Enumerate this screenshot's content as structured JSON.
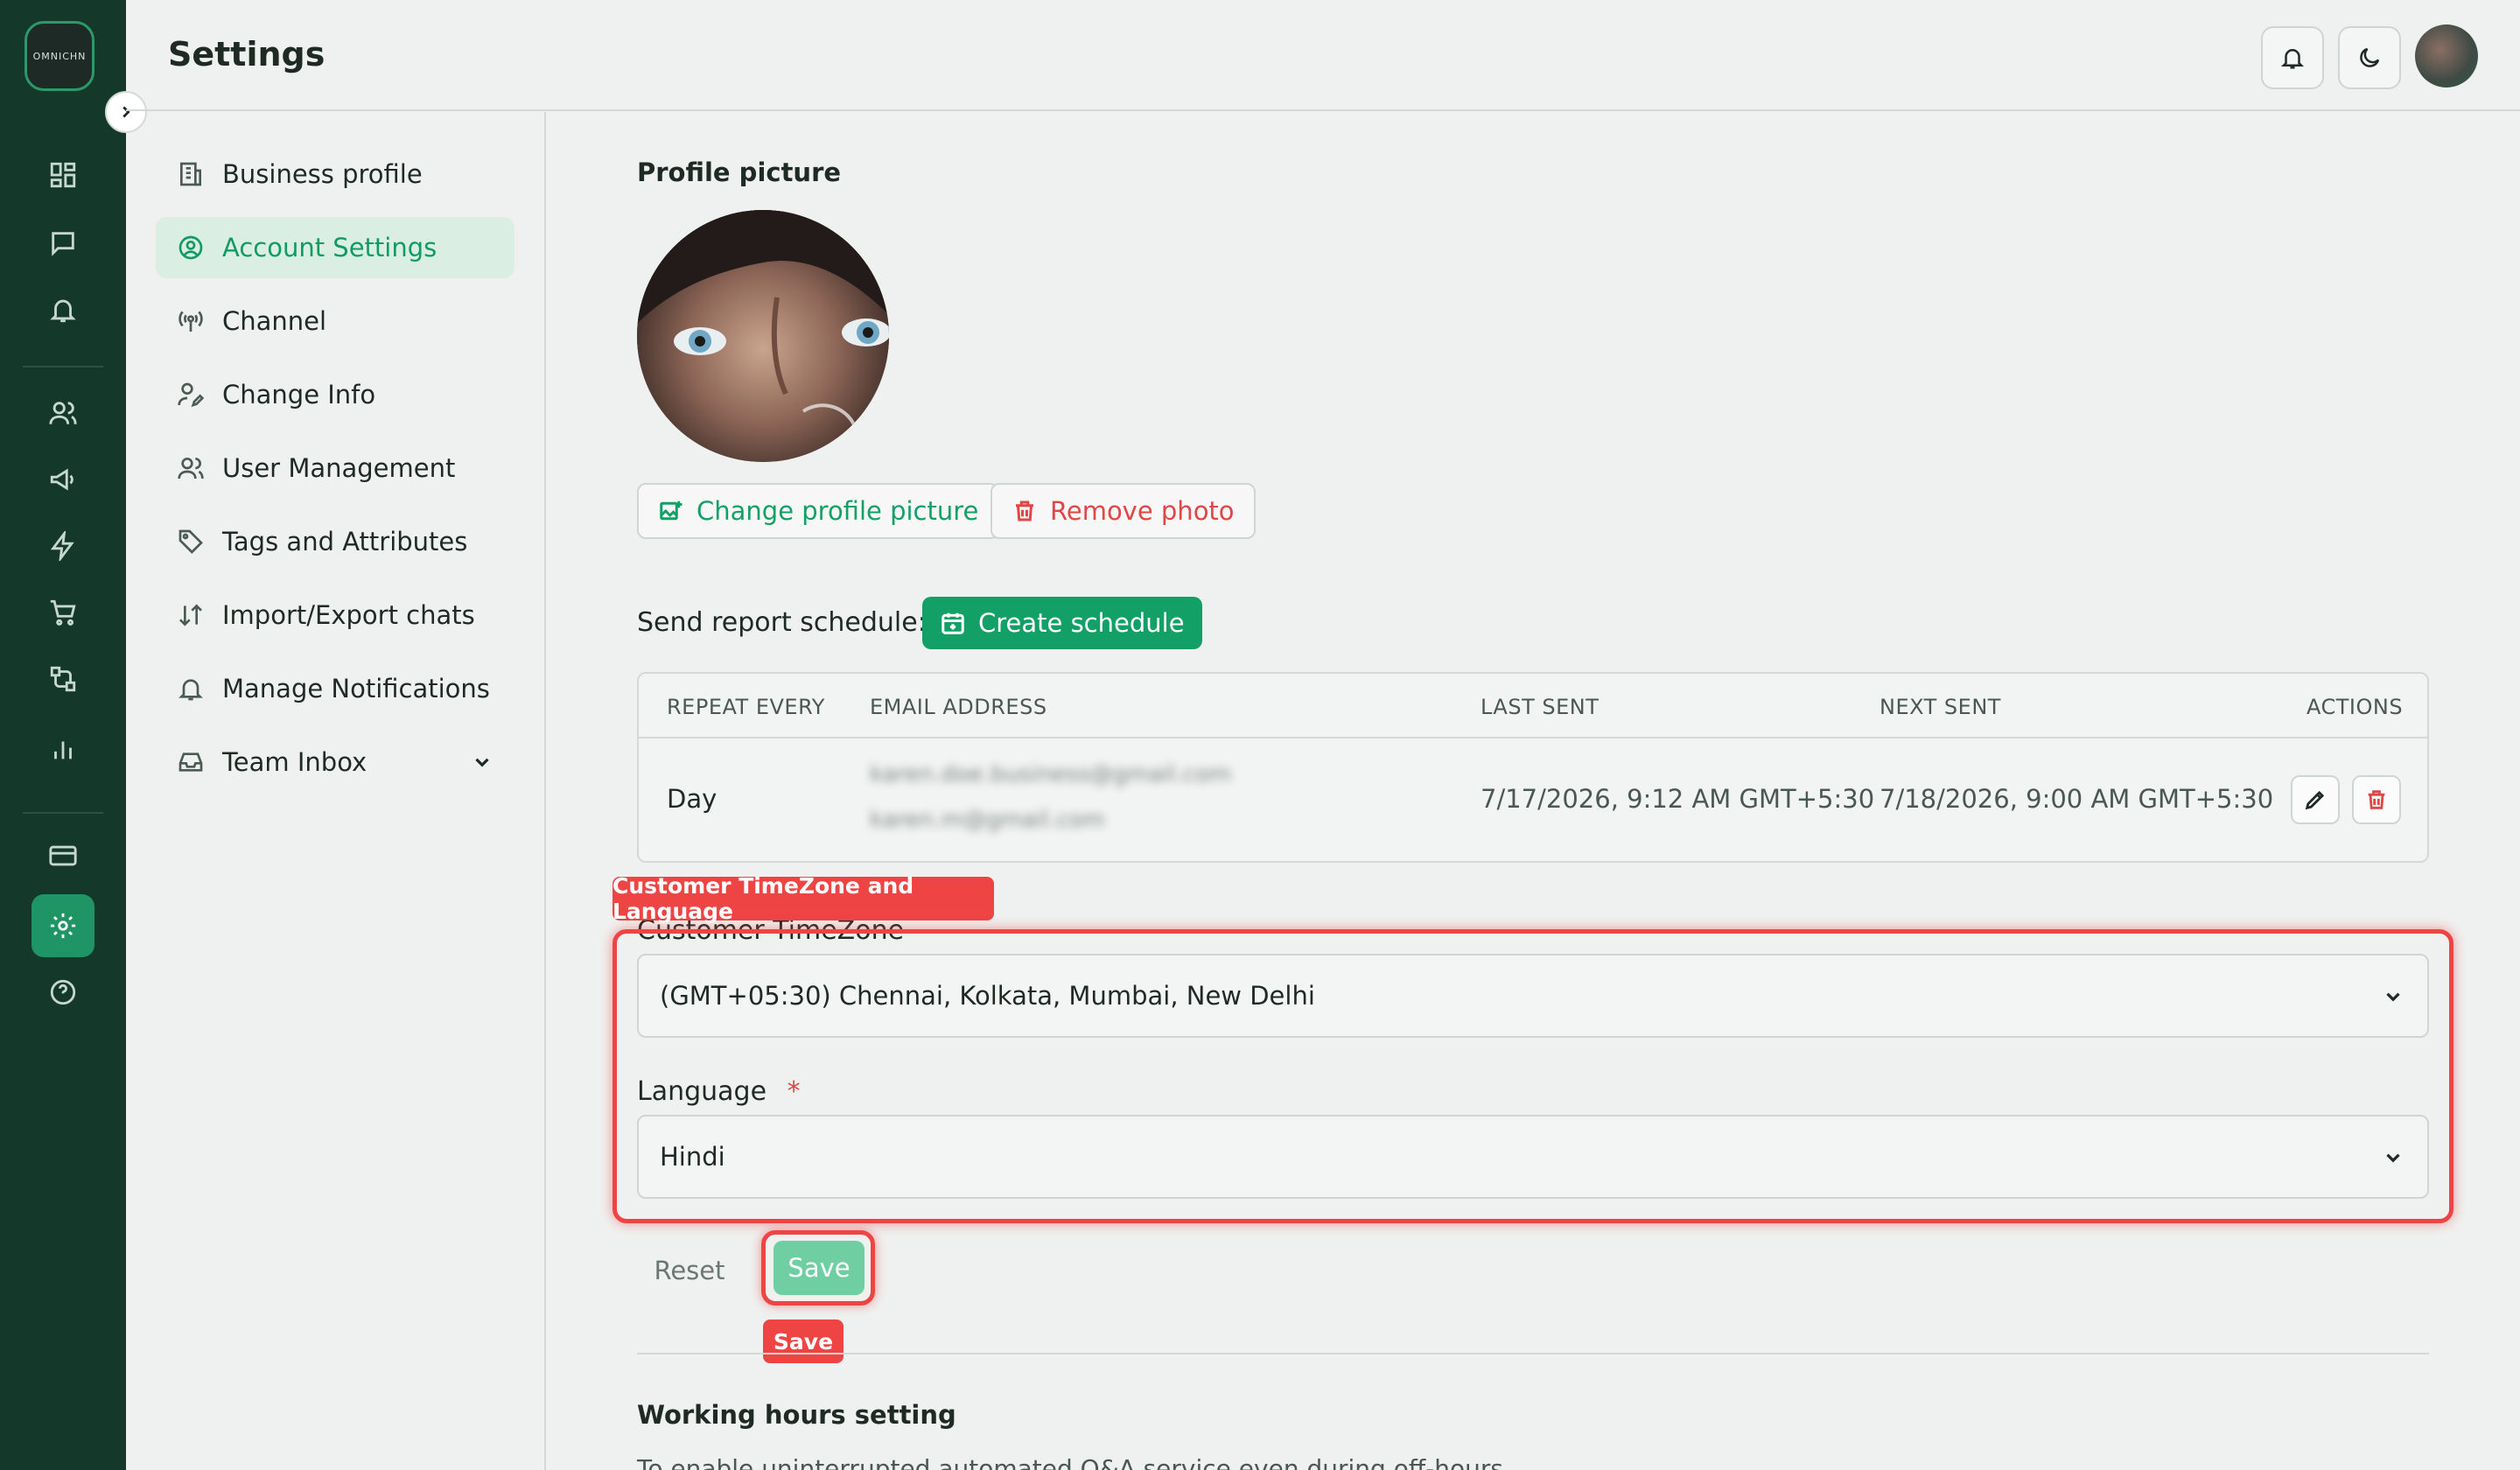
{
  "app": {
    "logo_text": "OMNICHN",
    "page_title": "Settings"
  },
  "rail": {
    "icons": [
      "dashboard-icon",
      "chat-icon",
      "bell-icon",
      "contacts-icon",
      "megaphone-icon",
      "bolt-icon",
      "cart-icon",
      "flow-icon",
      "bar-chart-icon",
      "card-icon",
      "settings-icon",
      "help-icon"
    ],
    "active": "settings-icon",
    "colors": {
      "bg": "#14392b",
      "active": "#1f9465"
    }
  },
  "header": {
    "icons": [
      "notification-bell-icon",
      "dark-mode-moon-icon"
    ]
  },
  "settings_nav": {
    "items": [
      {
        "label": "Business profile",
        "icon": "building-icon"
      },
      {
        "label": "Account Settings",
        "icon": "user-circle-icon",
        "active": true
      },
      {
        "label": "Channel",
        "icon": "broadcast-icon"
      },
      {
        "label": "Change Info",
        "icon": "user-edit-icon"
      },
      {
        "label": "User Management",
        "icon": "users-icon"
      },
      {
        "label": "Tags and Attributes",
        "icon": "tag-icon"
      },
      {
        "label": "Import/Export chats",
        "icon": "arrows-updown-icon"
      },
      {
        "label": "Manage Notifications",
        "icon": "bell-icon"
      },
      {
        "label": "Team Inbox",
        "icon": "inbox-icon",
        "expandable": true
      }
    ]
  },
  "profile": {
    "heading": "Profile picture",
    "change_label": "Change profile picture",
    "remove_label": "Remove photo"
  },
  "report": {
    "label": "Send report schedule:",
    "create_label": "Create schedule",
    "columns": [
      "REPEAT EVERY",
      "EMAIL ADDRESS",
      "LAST SENT",
      "NEXT SENT",
      "ACTIONS"
    ],
    "rows": [
      {
        "repeat": "Day",
        "emails": [
          "karen.doe.business@gmail.com",
          "karen.m@gmail.com"
        ],
        "last_sent": "7/17/2026, 9:12 AM GMT+5:30",
        "next_sent": "7/18/2026, 9:00 AM GMT+5:30"
      }
    ]
  },
  "locale": {
    "annotation": "Customer TimeZone and Language",
    "timezone_label": "Customer TimeZone",
    "timezone_value": "(GMT+05:30) Chennai, Kolkata, Mumbai, New Delhi",
    "language_label": "Language",
    "required_mark": "*",
    "language_value": "Hindi"
  },
  "actions": {
    "reset_label": "Reset",
    "save_label": "Save",
    "save_annotation": "Save"
  },
  "working_hours": {
    "heading": "Working hours setting",
    "description": "To enable uninterrupted automated Q&A service even during off-hours"
  },
  "colors": {
    "accent": "#12a067",
    "danger": "#e04646",
    "highlight": "#ef4444",
    "save_disabled": "#6fcfa3"
  }
}
